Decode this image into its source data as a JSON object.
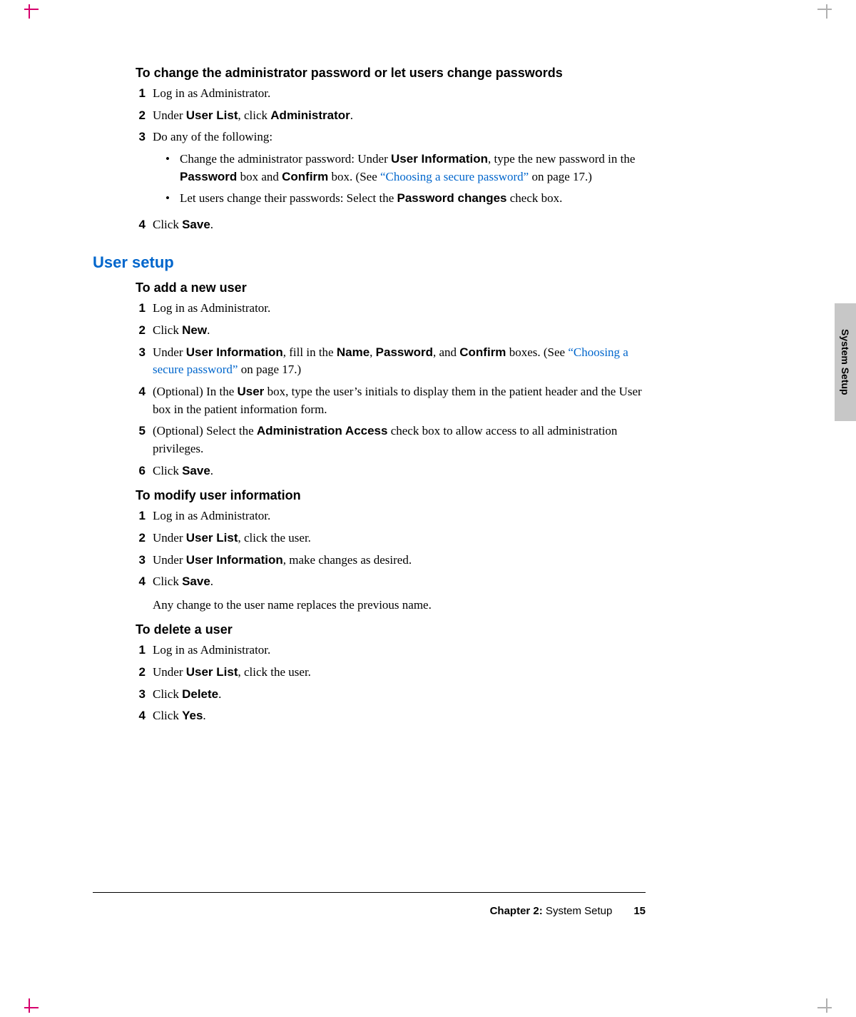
{
  "section1": {
    "title": "To change the administrator password or let users change passwords",
    "s1": "Log in as Administrator.",
    "s2a": "Under ",
    "s2b": "User List",
    "s2c": ", click ",
    "s2d": "Administrator",
    "s2e": ".",
    "s3": "Do any of the following:",
    "b1a": "Change the administrator password: Under ",
    "b1b": "User Information",
    "b1c": ", type the new password in the ",
    "b1d": "Password",
    "b1e": " box and ",
    "b1f": "Confirm",
    "b1g": " box. (See ",
    "b1link": "“Choosing a secure password”",
    "b1h": " on page 17.)",
    "b2a": "Let users change their passwords: Select the ",
    "b2b": "Password changes",
    "b2c": " check box.",
    "s4a": "Click ",
    "s4b": "Save",
    "s4c": "."
  },
  "h2": "User setup",
  "section2": {
    "title": "To add a new user",
    "s1": "Log in as Administrator.",
    "s2a": "Click ",
    "s2b": "New",
    "s2c": ".",
    "s3a": "Under ",
    "s3b": "User Information",
    "s3c": ", fill in the ",
    "s3d": "Name",
    "s3e": ", ",
    "s3f": "Password",
    "s3g": ", and ",
    "s3h": "Confirm",
    "s3i": " boxes. (See ",
    "s3link": "“Choosing a secure password”",
    "s3j": " on page 17.)",
    "s4a": "(Optional) In the ",
    "s4b": "User",
    "s4c": " box, type the user’s initials to display them in the patient header and the User box in the patient information form.",
    "s5a": "(Optional) Select the ",
    "s5b": "Administration Access",
    "s5c": " check box to allow access to all administration privileges.",
    "s6a": "Click ",
    "s6b": "Save",
    "s6c": "."
  },
  "section3": {
    "title": "To modify user information",
    "s1": "Log in as Administrator.",
    "s2a": "Under ",
    "s2b": "User List",
    "s2c": ", click the user.",
    "s3a": "Under ",
    "s3b": "User Information",
    "s3c": ", make changes as desired.",
    "s4a": "Click ",
    "s4b": "Save",
    "s4c": ".",
    "note": "Any change to the user name replaces the previous name."
  },
  "section4": {
    "title": "To delete a user",
    "s1": "Log in as Administrator.",
    "s2a": "Under ",
    "s2b": "User List",
    "s2c": ", click the user.",
    "s3a": "Click ",
    "s3b": "Delete",
    "s3c": ".",
    "s4a": "Click ",
    "s4b": "Yes",
    "s4c": "."
  },
  "side_tab": "System Setup",
  "footer": {
    "chapter": "Chapter 2:",
    "title": "  System Setup",
    "page": "15"
  }
}
